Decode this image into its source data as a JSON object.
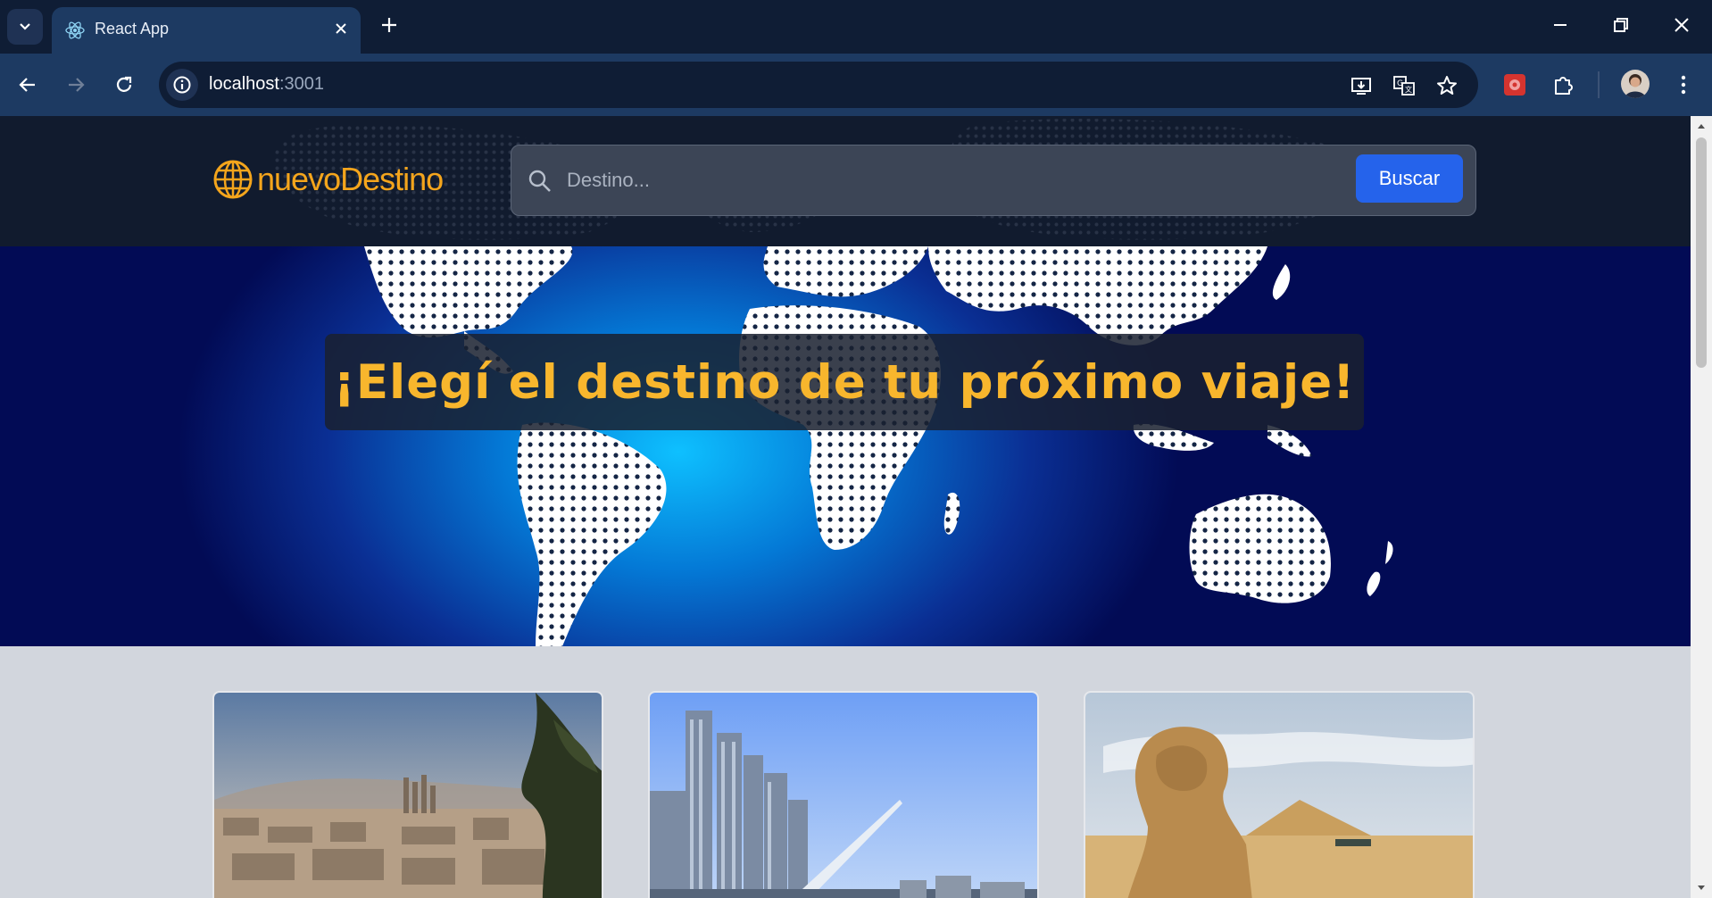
{
  "browser": {
    "tab_title": "React App",
    "url_host": "localhost",
    "url_port": ":3001",
    "icons": [
      "tab-search-icon",
      "react-icon",
      "close-icon",
      "new-tab-icon",
      "minimize-icon",
      "restore-icon",
      "window-close-icon",
      "back-icon",
      "forward-icon",
      "reload-icon",
      "info-icon",
      "install-icon",
      "translate-icon",
      "star-icon",
      "extension-icon",
      "puzzle-icon",
      "profile-avatar",
      "menu-icon"
    ]
  },
  "header": {
    "logo_text": "nuevoDestino",
    "search_placeholder": "Destino...",
    "search_button": "Buscar"
  },
  "hero": {
    "title": "¡Elegí el destino de tu próximo viaje!"
  },
  "cards": [
    {
      "image": "barcelona-cityscape"
    },
    {
      "image": "buenos-aires-skyline"
    },
    {
      "image": "sphinx-egypt"
    }
  ],
  "colors": {
    "accent": "#f4a51c",
    "button": "#2563eb",
    "header_bg": "#111b2e",
    "chrome_bg": "#0f1d35",
    "page_bg": "#d2d6dd"
  }
}
